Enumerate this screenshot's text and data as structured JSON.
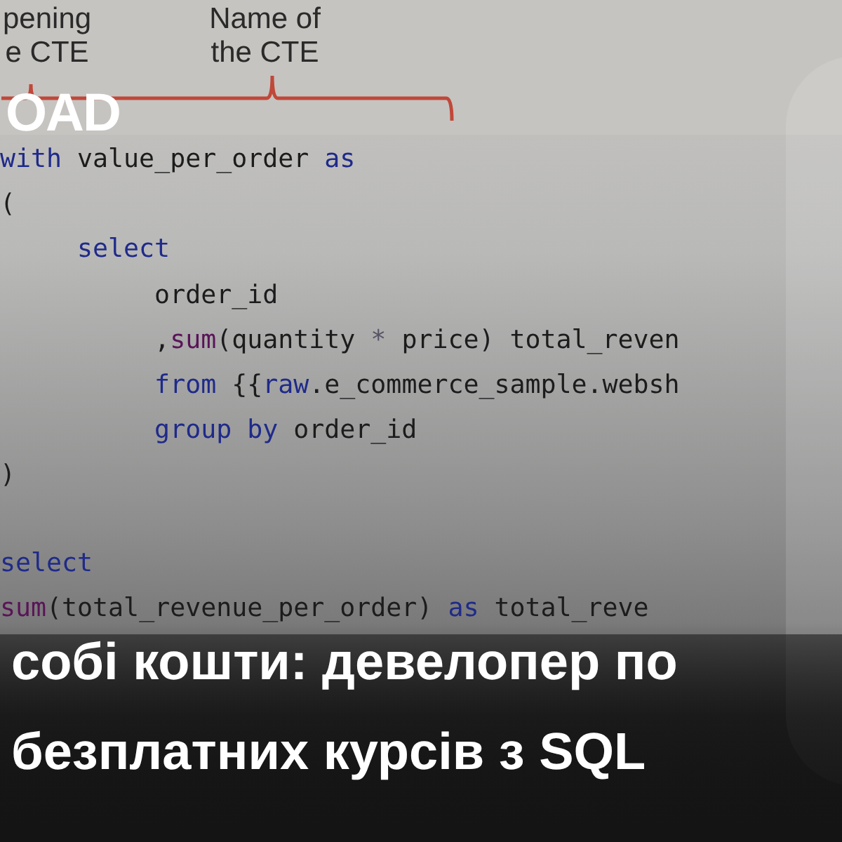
{
  "annotations": [
    {
      "lines": [
        "pening",
        "e CTE"
      ]
    },
    {
      "lines": [
        "Name of",
        "the CTE"
      ]
    }
  ],
  "logo": "OAD",
  "code": [
    {
      "lines": [
        {
          "tokens": [
            {
              "kind": "keyword",
              "text": "with"
            },
            {
              "kind": "plain",
              "text": " value_per_order "
            },
            {
              "kind": "keyword",
              "text": "as"
            }
          ]
        },
        {
          "tokens": [
            {
              "kind": "plain",
              "text": "("
            }
          ]
        },
        {
          "tokens": [
            {
              "kind": "keyword",
              "text": "     select"
            }
          ]
        },
        {
          "tokens": [
            {
              "kind": "plain",
              "text": "          order_id"
            }
          ]
        },
        {
          "tokens": [
            {
              "kind": "plain",
              "text": "          ,"
            },
            {
              "kind": "function",
              "text": "sum"
            },
            {
              "kind": "plain",
              "text": "(quantity "
            },
            {
              "kind": "operator",
              "text": "*"
            },
            {
              "kind": "plain",
              "text": " price) total_reven"
            }
          ]
        },
        {
          "tokens": [
            {
              "kind": "keyword",
              "text": "          from"
            },
            {
              "kind": "plain",
              "text": " {{"
            },
            {
              "kind": "keyword",
              "text": "raw"
            },
            {
              "kind": "plain",
              "text": ".e_commerce_sample.websh"
            }
          ]
        },
        {
          "tokens": [
            {
              "kind": "keyword",
              "text": "          group by"
            },
            {
              "kind": "plain",
              "text": " order_id"
            }
          ]
        },
        {
          "tokens": [
            {
              "kind": "plain",
              "text": ")"
            }
          ]
        }
      ]
    },
    {
      "lines": [
        {
          "tokens": [
            {
              "kind": "keyword",
              "text": "select"
            }
          ]
        },
        {
          "tokens": [
            {
              "kind": "function",
              "text": "sum"
            },
            {
              "kind": "plain",
              "text": "(total_revenue_per_order) "
            },
            {
              "kind": "keyword",
              "text": "as"
            },
            {
              "kind": "plain",
              "text": " total_reve"
            }
          ]
        }
      ]
    }
  ],
  "headline": [
    "собі кошти: девелопер по",
    "безплатних курсів з SQL"
  ]
}
